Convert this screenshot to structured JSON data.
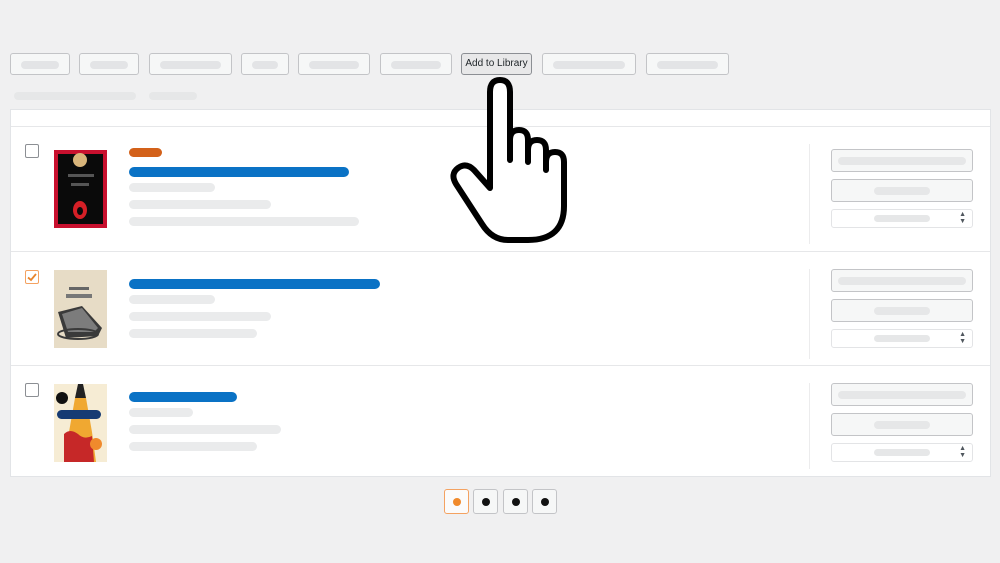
{
  "toolbar": {
    "active_button_label": "Add to Library"
  },
  "list": {
    "items": [
      {
        "checked": false,
        "badge_color": "#d3611a",
        "cover": "dark-red-bordered-cover"
      },
      {
        "checked": true,
        "cover": "beige-cover-with-tray"
      },
      {
        "checked": false,
        "cover": "cover-with-pencil-figure"
      }
    ]
  },
  "pagination": {
    "pages": 4,
    "current_page": 1
  },
  "colors": {
    "accent": "#f08a2c",
    "link_blue": "#0a72c5",
    "badge_orange": "#d3611a",
    "background": "#f0f0f1"
  },
  "icons": {
    "pointer": "pointing-hand-cursor-icon",
    "select_arrows": "select-arrows-icon",
    "check": "checkmark-icon"
  }
}
